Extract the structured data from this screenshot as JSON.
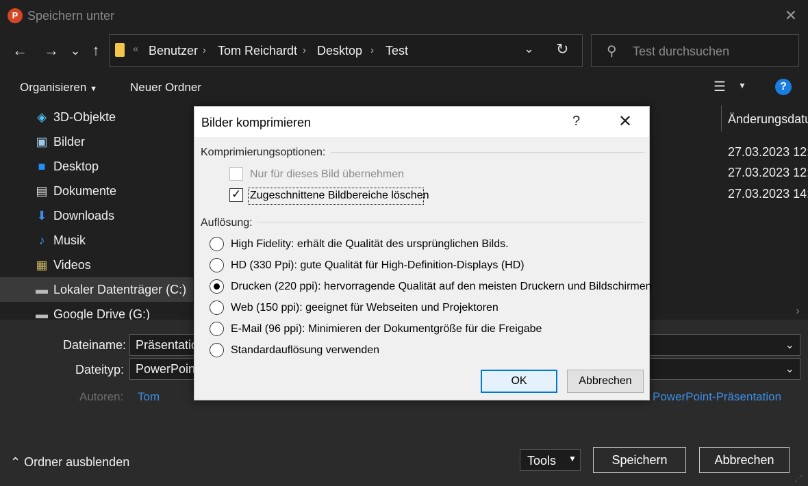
{
  "window": {
    "title": "Speichern unter",
    "app_logo_letter": "P"
  },
  "nav": {
    "back": "←",
    "forward": "→",
    "history": "⌄",
    "up": "↑"
  },
  "address": {
    "overflow": "«",
    "crumbs": [
      "Benutzer",
      "Tom Reichardt",
      "Desktop",
      "Test"
    ]
  },
  "search": {
    "placeholder": "Test durchsuchen"
  },
  "toolbar": {
    "organize": "Organisieren",
    "new_folder": "Neuer Ordner"
  },
  "sidebar": {
    "items": [
      {
        "label": "3D-Objekte",
        "icon": "cube-icon"
      },
      {
        "label": "Bilder",
        "icon": "pictures-icon"
      },
      {
        "label": "Desktop",
        "icon": "desktop-icon"
      },
      {
        "label": "Dokumente",
        "icon": "document-icon"
      },
      {
        "label": "Downloads",
        "icon": "download-icon"
      },
      {
        "label": "Musik",
        "icon": "music-icon"
      },
      {
        "label": "Videos",
        "icon": "video-icon"
      },
      {
        "label": "Lokaler Datenträger (C:)",
        "icon": "drive-icon",
        "selected": true
      },
      {
        "label": "Google Drive (G:)",
        "icon": "drive-icon"
      }
    ]
  },
  "filelist": {
    "column_header": "Änderungsdatu",
    "dates": [
      "27.03.2023 12:",
      "27.03.2023 12:",
      "27.03.2023 14:"
    ]
  },
  "form": {
    "filename_label": "Dateiname:",
    "filename_value": "Präsentatio",
    "filetype_label": "Dateityp:",
    "filetype_value": "PowerPoint",
    "authors_label": "Autoren:",
    "authors_value": "Tom",
    "filetype_right": "PowerPoint-Präsentation"
  },
  "bottom": {
    "hide_folders": "Ordner ausblenden",
    "tools": "Tools",
    "save": "Speichern",
    "cancel": "Abbrechen"
  },
  "dialog": {
    "title": "Bilder komprimieren",
    "help": "?",
    "compression_group": "Komprimierungsoptionen:",
    "only_this_picture": "Nur für dieses Bild übernehmen",
    "only_this_picture_checked": false,
    "delete_cropped": "Zugeschnittene Bildbereiche löschen",
    "delete_cropped_checked": true,
    "resolution_group": "Auflösung:",
    "resolutions": [
      {
        "label": "High Fidelity: erhält die Qualität des ursprünglichen Bilds.",
        "selected": false
      },
      {
        "label": "HD (330 Ppi): gute Qualität für High-Definition-Displays (HD)",
        "selected": false
      },
      {
        "label": "Drucken (220 ppi): hervorragende Qualität auf den meisten Druckern und Bildschirmen",
        "selected": true
      },
      {
        "label": "Web (150 ppi): geeignet für Webseiten und Projektoren",
        "selected": false
      },
      {
        "label": "E-Mail (96 ppi): Minimieren der Dokumentgröße für die Freigabe",
        "selected": false
      },
      {
        "label": "Standardauflösung verwenden",
        "selected": false
      }
    ],
    "ok": "OK",
    "cancel": "Abbrechen"
  },
  "colors": {
    "accent": "#0078d7",
    "link": "#3d8ee6",
    "ppt": "#d24726"
  }
}
